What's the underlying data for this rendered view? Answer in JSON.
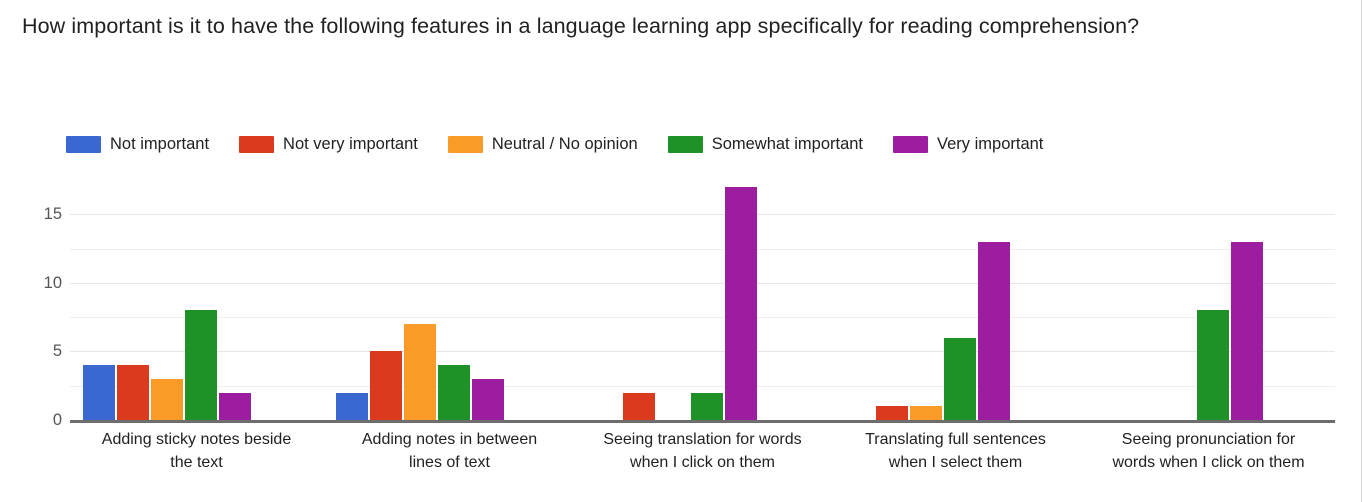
{
  "chart_data": {
    "type": "bar",
    "title": "How important is it to have the following features in a language learning app specifically for reading comprehension?",
    "xlabel": "",
    "ylabel": "",
    "ylim": [
      0,
      17.5
    ],
    "yticks": [
      0,
      5,
      10,
      15
    ],
    "ytick_labels": [
      "0",
      "5",
      "10",
      "15"
    ],
    "gridlines": [
      0,
      2.5,
      5,
      7.5,
      10,
      12.5,
      15
    ],
    "grid": true,
    "legend_position": "top-left",
    "categories": [
      "Adding sticky notes beside the text",
      "Adding notes in between lines of text",
      "Seeing translation for words when I click on them",
      "Translating full sentences when I select them",
      "Seeing pronunciation for words when I click on them"
    ],
    "category_lines": [
      [
        "Adding sticky notes beside",
        "the text"
      ],
      [
        "Adding notes in between",
        "lines of text"
      ],
      [
        "Seeing translation for words",
        "when I click on them"
      ],
      [
        "Translating full sentences",
        "when I select them"
      ],
      [
        "Seeing pronunciation for",
        "words when I click on them"
      ]
    ],
    "series": [
      {
        "name": "Not important",
        "color": "#3a68d0",
        "values": [
          4,
          2,
          0,
          0,
          0
        ]
      },
      {
        "name": "Not very important",
        "color": "#dc3a1f",
        "values": [
          4,
          5,
          2,
          1,
          0
        ]
      },
      {
        "name": "Neutral / No opinion",
        "color": "#fa9b28",
        "values": [
          3,
          7,
          0,
          1,
          0
        ]
      },
      {
        "name": "Somewhat important",
        "color": "#1e9226",
        "values": [
          8,
          4,
          2,
          6,
          8
        ]
      },
      {
        "name": "Very important",
        "color": "#9d1da0",
        "values": [
          2,
          3,
          17,
          13,
          13
        ]
      }
    ]
  }
}
